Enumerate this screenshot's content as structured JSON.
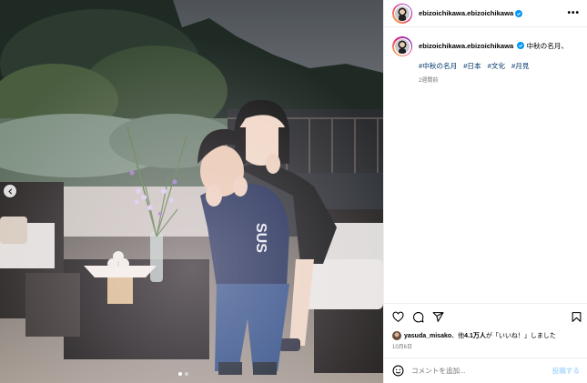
{
  "post": {
    "username": "ebizoichikawa.ebizoichikawa",
    "more_label": "•••",
    "caption": "中秋の名月、",
    "hashtags": [
      "#中秋の名月",
      "#日本",
      "#文化",
      "#月見"
    ],
    "time_ago": "2週間前",
    "liked_by_user": "yasuda_misako",
    "likes_middle": "、他",
    "likes_count": "4.1万人",
    "likes_suffix": "が「いいね！」しました",
    "date": "10月6日",
    "comment_placeholder": "コメントを追加...",
    "post_button": "投稿する"
  },
  "carousel": {
    "current": 1,
    "total": 2
  },
  "colors": {
    "accent": "#0095f6",
    "hashtag": "#00376b",
    "verified": "#0095f6"
  },
  "icons": [
    "chevron-left-icon",
    "verified-badge-icon",
    "heart-icon",
    "comment-icon",
    "share-icon",
    "bookmark-icon",
    "emoji-icon"
  ]
}
